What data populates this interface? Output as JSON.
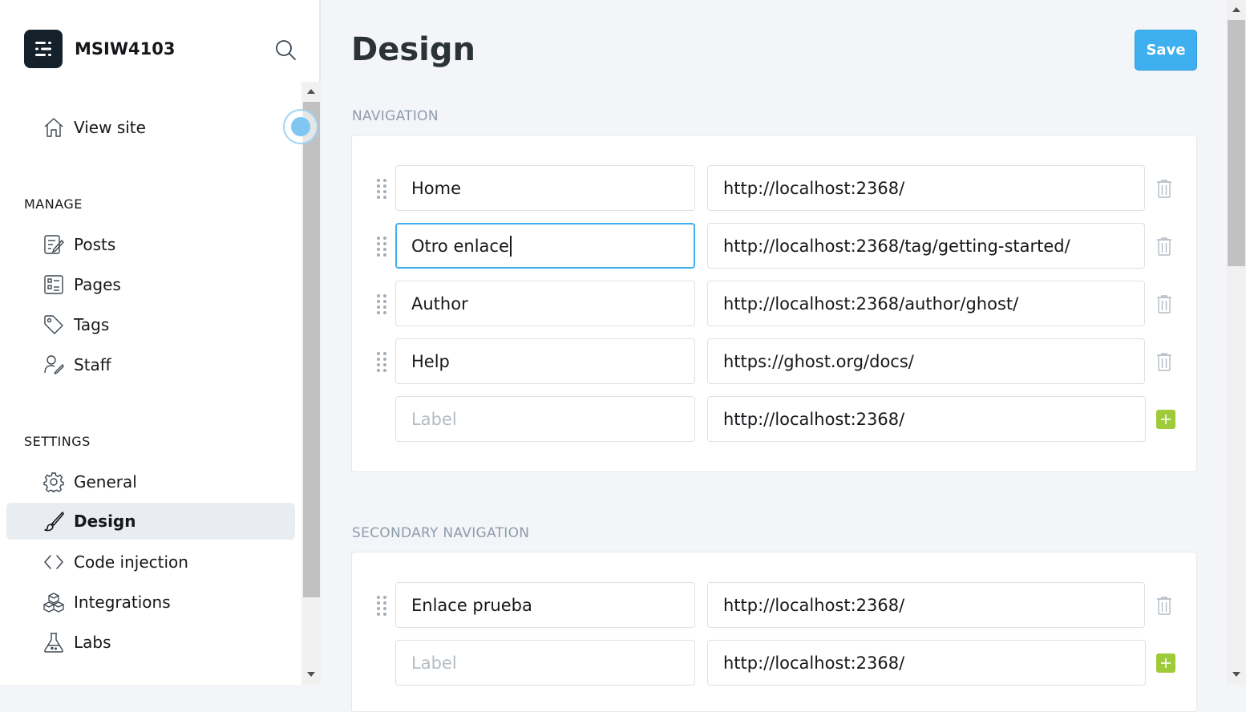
{
  "sidebar": {
    "site_name": "MSIW4103",
    "view_site": "View site",
    "manage_heading": "MANAGE",
    "manage_items": [
      {
        "label": "Posts",
        "icon": "posts-icon"
      },
      {
        "label": "Pages",
        "icon": "pages-icon"
      },
      {
        "label": "Tags",
        "icon": "tag-icon"
      },
      {
        "label": "Staff",
        "icon": "staff-icon"
      }
    ],
    "settings_heading": "SETTINGS",
    "settings_items": [
      {
        "label": "General",
        "icon": "gear-icon"
      },
      {
        "label": "Design",
        "icon": "brush-icon",
        "active": true
      },
      {
        "label": "Code injection",
        "icon": "code-icon"
      },
      {
        "label": "Integrations",
        "icon": "integrations-icon"
      },
      {
        "label": "Labs",
        "icon": "flask-icon"
      }
    ]
  },
  "main": {
    "title": "Design",
    "save_label": "Save",
    "navigation": {
      "heading": "NAVIGATION",
      "items": [
        {
          "label": "Home",
          "url": "http://localhost:2368/"
        },
        {
          "label": "Otro enlace",
          "url": "http://localhost:2368/tag/getting-started/",
          "focused": true
        },
        {
          "label": "Author",
          "url": "http://localhost:2368/author/ghost/"
        },
        {
          "label": "Help",
          "url": "https://ghost.org/docs/"
        }
      ],
      "new_item": {
        "label_placeholder": "Label",
        "url": "http://localhost:2368/"
      }
    },
    "secondary_navigation": {
      "heading": "SECONDARY NAVIGATION",
      "items": [
        {
          "label": "Enlace prueba",
          "url": "http://localhost:2368/"
        }
      ],
      "new_item": {
        "label_placeholder": "Label",
        "url": "http://localhost:2368/"
      }
    }
  },
  "colors": {
    "accent": "#3eb0ef",
    "add_button": "#9fcb3a",
    "active_nav_bg": "#e9ecf1"
  }
}
